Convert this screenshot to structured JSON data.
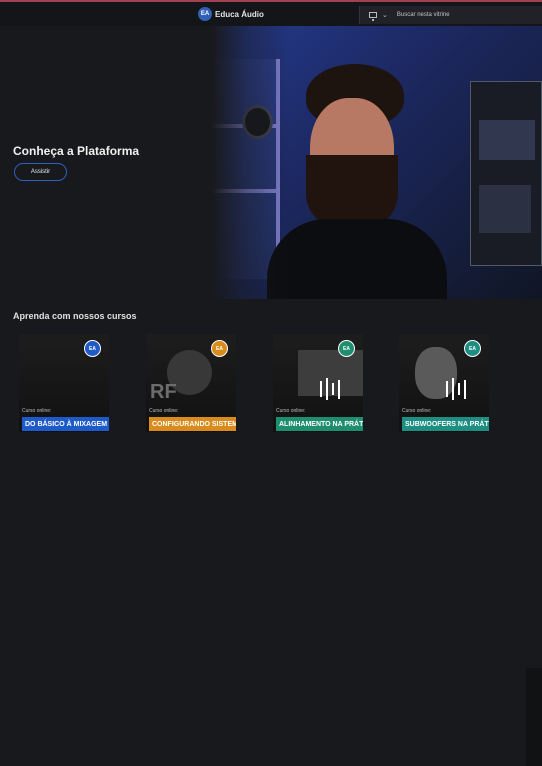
{
  "topbar": {
    "brand_badge": "EA",
    "brand_name": "Educa Áudio",
    "search_placeholder": "Buscar nesta vitrine"
  },
  "hero": {
    "title": "Conheça a Plataforma",
    "button_label": "Assistir"
  },
  "courses_section": {
    "title": "Aprenda com nossos cursos"
  },
  "courses": [
    {
      "badge": "EA",
      "label": "Curso online:",
      "title": "DO BÁSICO À MIXAGEM",
      "color": "#1f5bc8"
    },
    {
      "badge": "EA",
      "label": "Curso online:",
      "title": "CONFIGURANDO SISTEMAS",
      "color": "#d98b1d"
    },
    {
      "badge": "EA",
      "label": "Curso online:",
      "title": "ALINHAMENTO NA PRÁTICA",
      "color": "#1f8d6f"
    },
    {
      "badge": "EA",
      "label": "Curso online:",
      "title": "SUBWOOFERS NA PRÁTICA",
      "color": "#1d8e81"
    }
  ]
}
